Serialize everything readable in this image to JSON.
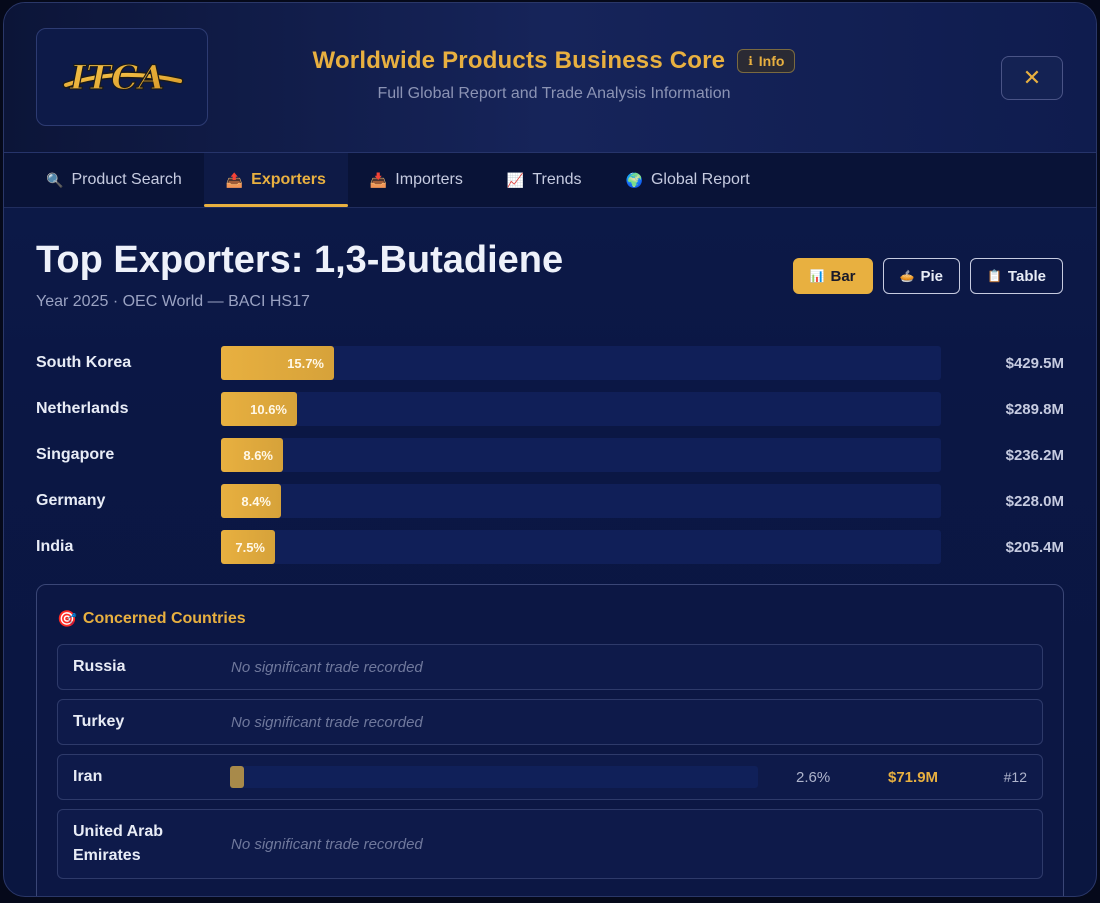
{
  "header": {
    "logo_text": "ITCA",
    "title": "Worldwide Products Business Core",
    "info_label": "Info",
    "subtitle": "Full Global Report and Trade Analysis Information",
    "close_symbol": "✕"
  },
  "tabs": [
    {
      "label": "Product Search",
      "icon": "🔍",
      "active": false
    },
    {
      "label": "Exporters",
      "icon": "📤",
      "active": true
    },
    {
      "label": "Importers",
      "icon": "📥",
      "active": false
    },
    {
      "label": "Trends",
      "icon": "📈",
      "active": false
    },
    {
      "label": "Global Report",
      "icon": "🌍",
      "active": false
    }
  ],
  "main": {
    "title": "Top Exporters: 1,3-Butadiene",
    "subtitle": "Year 2025 · OEC World — BACI HS17",
    "view_buttons": [
      {
        "label": "Bar",
        "icon": "📊",
        "active": true
      },
      {
        "label": "Pie",
        "icon": "🥧",
        "active": false
      },
      {
        "label": "Table",
        "icon": "📋",
        "active": false
      }
    ]
  },
  "exporters": [
    {
      "country": "South Korea",
      "share_pct": 15.7,
      "share_label": "15.7%",
      "value": "$429.5M"
    },
    {
      "country": "Netherlands",
      "share_pct": 10.6,
      "share_label": "10.6%",
      "value": "$289.8M"
    },
    {
      "country": "Singapore",
      "share_pct": 8.6,
      "share_label": "8.6%",
      "value": "$236.2M"
    },
    {
      "country": "Germany",
      "share_pct": 8.4,
      "share_label": "8.4%",
      "value": "$228.0M"
    },
    {
      "country": "India",
      "share_pct": 7.5,
      "share_label": "7.5%",
      "value": "$205.4M"
    }
  ],
  "concerned": {
    "title": "Concerned Countries",
    "icon": "🎯",
    "no_trade_text": "No significant trade recorded",
    "rows": [
      {
        "country": "Russia",
        "has_trade": false
      },
      {
        "country": "Turkey",
        "has_trade": false
      },
      {
        "country": "Iran",
        "has_trade": true,
        "share_pct": 2.6,
        "share_label": "2.6%",
        "value": "$71.9M",
        "rank": "#12"
      },
      {
        "country": "United Arab Emirates",
        "has_trade": false
      }
    ]
  },
  "colors": {
    "accent": "#e8b040",
    "background": "#0b1745",
    "bar_track": "#101f58"
  }
}
